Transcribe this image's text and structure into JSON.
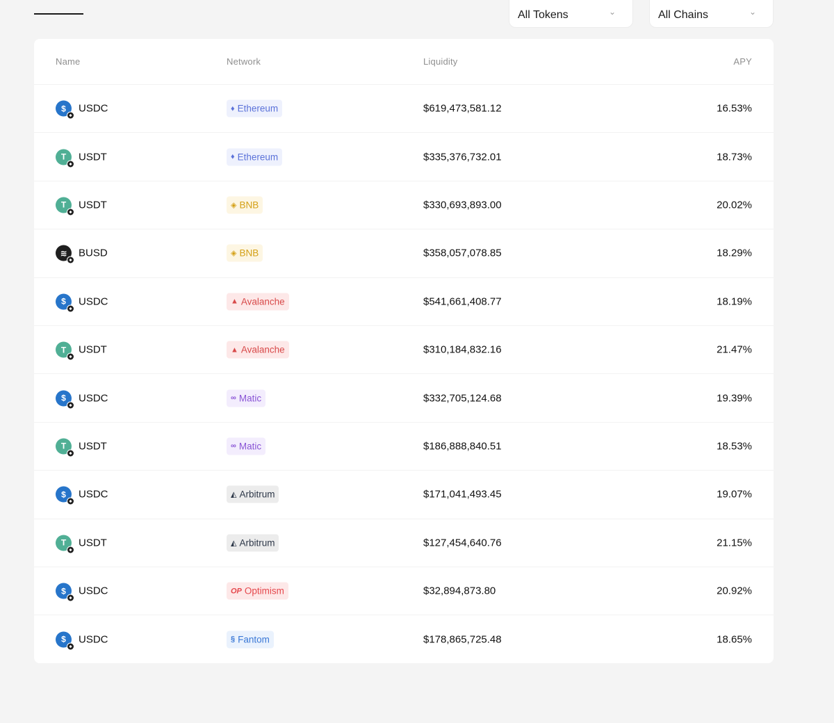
{
  "filters": {
    "tokens_label": "All Tokens",
    "chains_label": "All Chains"
  },
  "columns": {
    "name": "Name",
    "network": "Network",
    "liquidity": "Liquidity",
    "apy": "APY"
  },
  "token_styles": {
    "USDC": {
      "icon": "usdc-icon",
      "bg": "#2775ca",
      "glyph": "$"
    },
    "USDT": {
      "icon": "usdt-icon",
      "bg": "#50af95",
      "glyph": "T"
    },
    "BUSD": {
      "icon": "busd-icon",
      "bg": "#1f1f1f",
      "glyph": "≋"
    }
  },
  "network_styles": {
    "Ethereum": {
      "icon": "ethereum-icon",
      "glyph": "♦",
      "bg": "#eef1fd",
      "color": "#5b72d9"
    },
    "BNB": {
      "icon": "bnb-icon",
      "glyph": "◈",
      "bg": "#fdf6e3",
      "color": "#d4a017"
    },
    "Avalanche": {
      "icon": "avalanche-icon",
      "glyph": "▲",
      "bg": "#fde8e8",
      "color": "#d84a4a"
    },
    "Matic": {
      "icon": "matic-icon",
      "glyph": "∞",
      "bg": "#f3edfd",
      "color": "#8a55d6"
    },
    "Arbitrum": {
      "icon": "arbitrum-icon",
      "glyph": "◭",
      "bg": "#ececec",
      "color": "#2d3748"
    },
    "Optimism": {
      "icon": "optimism-icon",
      "glyph": "OP",
      "bg": "#fde8e8",
      "color": "#e5484d"
    },
    "Fantom": {
      "icon": "fantom-icon",
      "glyph": "§",
      "bg": "#eaf2fd",
      "color": "#3a78d6"
    }
  },
  "rows": [
    {
      "token": "USDC",
      "network": "Ethereum",
      "liquidity": "$619,473,581.12",
      "apy": "16.53%"
    },
    {
      "token": "USDT",
      "network": "Ethereum",
      "liquidity": "$335,376,732.01",
      "apy": "18.73%"
    },
    {
      "token": "USDT",
      "network": "BNB",
      "liquidity": "$330,693,893.00",
      "apy": "20.02%"
    },
    {
      "token": "BUSD",
      "network": "BNB",
      "liquidity": "$358,057,078.85",
      "apy": "18.29%"
    },
    {
      "token": "USDC",
      "network": "Avalanche",
      "liquidity": "$541,661,408.77",
      "apy": "18.19%"
    },
    {
      "token": "USDT",
      "network": "Avalanche",
      "liquidity": "$310,184,832.16",
      "apy": "21.47%"
    },
    {
      "token": "USDC",
      "network": "Matic",
      "liquidity": "$332,705,124.68",
      "apy": "19.39%"
    },
    {
      "token": "USDT",
      "network": "Matic",
      "liquidity": "$186,888,840.51",
      "apy": "18.53%"
    },
    {
      "token": "USDC",
      "network": "Arbitrum",
      "liquidity": "$171,041,493.45",
      "apy": "19.07%"
    },
    {
      "token": "USDT",
      "network": "Arbitrum",
      "liquidity": "$127,454,640.76",
      "apy": "21.15%"
    },
    {
      "token": "USDC",
      "network": "Optimism",
      "liquidity": "$32,894,873.80",
      "apy": "20.92%"
    },
    {
      "token": "USDC",
      "network": "Fantom",
      "liquidity": "$178,865,725.48",
      "apy": "18.65%"
    }
  ]
}
